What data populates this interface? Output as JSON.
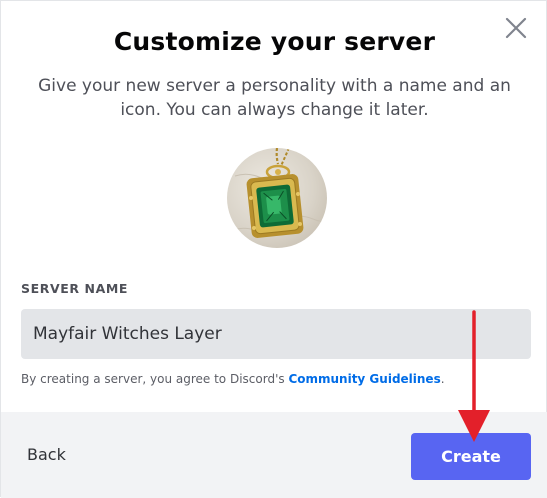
{
  "modal": {
    "title": "Customize your server",
    "subtitle": "Give your new server a personality with a name and an icon. You can always change it later.",
    "close_icon": "close-x",
    "server_icon": "emerald-pendant-image"
  },
  "form": {
    "label": "SERVER NAME",
    "value": "Mayfair Witches Layer"
  },
  "terms": {
    "prefix": "By creating a server, you agree to Discord's ",
    "link": "Community Guidelines",
    "suffix": "."
  },
  "footer": {
    "back_label": "Back",
    "create_label": "Create"
  },
  "colors": {
    "accent": "#5865f2",
    "link": "#006ce7",
    "annotation_arrow": "#e3202a"
  }
}
